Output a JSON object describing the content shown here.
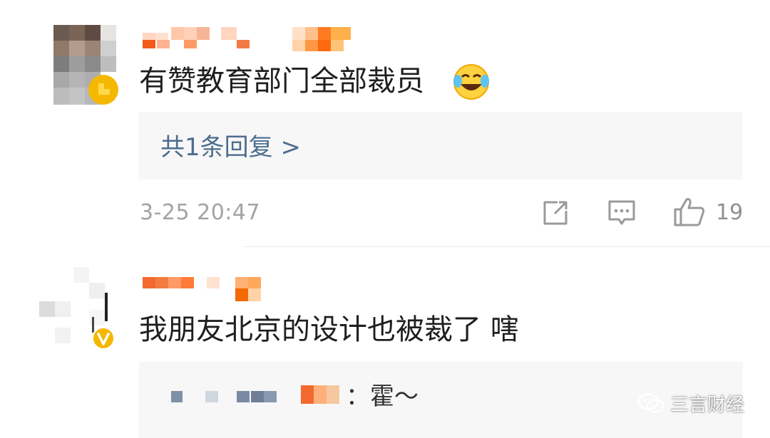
{
  "comments": [
    {
      "text": "有赞教育部门全部裁员",
      "emoji": "laughing-crying-emoji",
      "reply_link": "共1条回复 >",
      "timestamp": "3-25 20:47",
      "like_count": "19",
      "badge_color": "#f5b800"
    },
    {
      "text": "我朋友北京的设计也被裁了 嗐",
      "reply_preview_text": "：霍～",
      "badge_color": "#f5b800"
    }
  ],
  "actions": {
    "icons": [
      "share-icon",
      "comment-icon",
      "like-icon"
    ]
  },
  "watermark": {
    "text": "三言财经",
    "icon": "wechat-icon"
  },
  "colors": {
    "reply_link": "#4d6d8e",
    "timestamp": "#a3a3a3",
    "reply_box_bg": "#f7f7f7"
  }
}
